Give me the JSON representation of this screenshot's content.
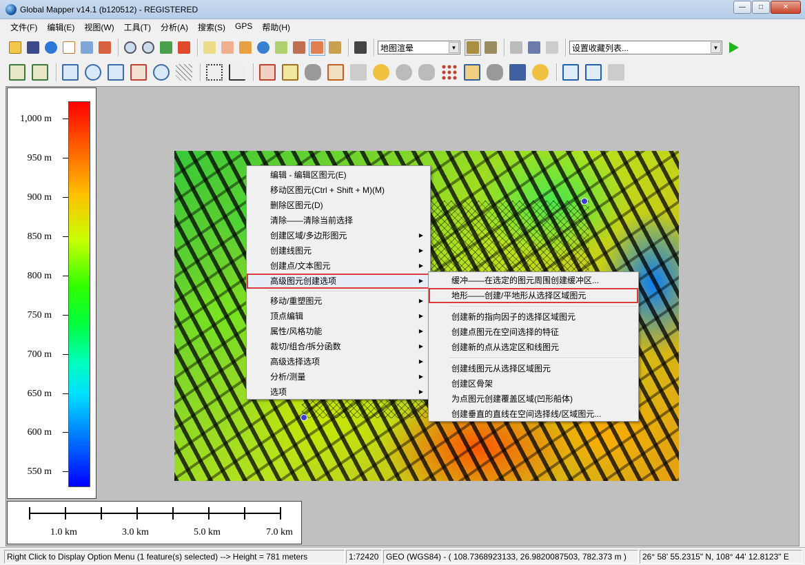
{
  "window": {
    "title": "Global Mapper v14.1 (b120512) - REGISTERED",
    "min_label": "—",
    "max_label": "□",
    "close_label": "✕"
  },
  "menubar": [
    "文件(F)",
    "编辑(E)",
    "视图(W)",
    "工具(T)",
    "分析(A)",
    "搜索(S)",
    "GPS",
    "帮助(H)"
  ],
  "toolbar": {
    "shader_combo": "地图渲晕",
    "favorites_combo": "设置收藏列表..."
  },
  "legend": {
    "ticks": [
      "1,000 m",
      "950 m",
      "900 m",
      "850 m",
      "800 m",
      "750 m",
      "700 m",
      "650 m",
      "600 m",
      "550 m"
    ]
  },
  "scalebar": {
    "labels": [
      "1.0 km",
      "3.0 km",
      "5.0 km",
      "7.0 km"
    ]
  },
  "context_menu": {
    "items": [
      "编辑 - 编辑区图元(E)",
      "移动区图元(Ctrl + Shift + M)(M)",
      "删除区图元(D)",
      "清除——清除当前选择",
      "创建区域/多边形图元",
      "创建线图元",
      "创建点/文本图元",
      "高级图元创建选项",
      "移动/重塑图元",
      "顶点编辑",
      "属性/风格功能",
      "裁切/组合/拆分函数",
      "高级选择选项",
      "分析/测量",
      "选项"
    ]
  },
  "submenu": {
    "items": [
      "缓冲——在选定的图元周围创建缓冲区...",
      "地形——创建/平地形从选择区域图元",
      "创建新的指向因子的选择区域图元",
      "创建点图元在空间选择的特征",
      "创建新的点从选定区和线图元",
      "创建线图元从选择区域图元",
      "创建区骨架",
      "为点图元创建覆盖区域(凹形船体)",
      "创建垂直的直线在空间选择线/区域图元..."
    ]
  },
  "statusbar": {
    "message": "Right Click to Display Option Menu (1 feature(s) selected) --> Height = 781 meters",
    "scale": "1:72420",
    "coords": "GEO (WGS84) - ( 108.7368923133, 26.9820087503, 782.373 m )",
    "dms": "26° 58' 55.2315\" N, 108° 44' 12.8123\" E"
  },
  "colors": {
    "highlight_border": "#d93a3a",
    "titlebar": "#b6cde8"
  }
}
